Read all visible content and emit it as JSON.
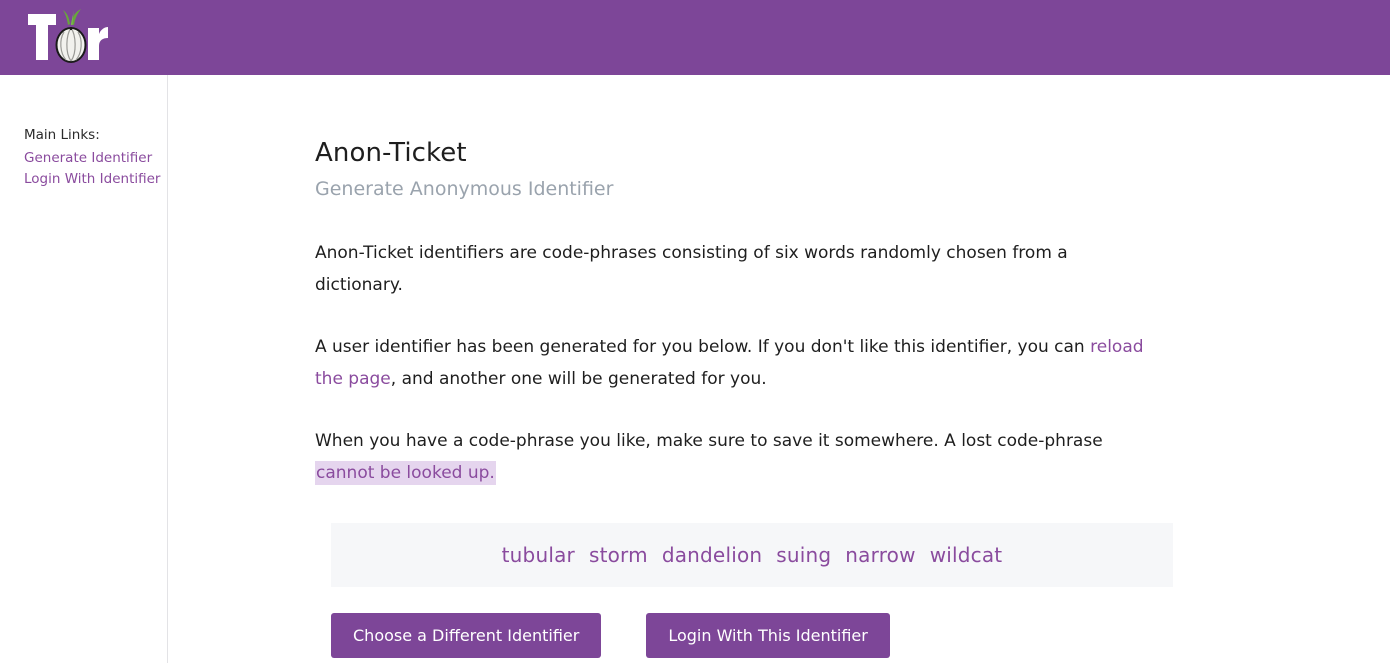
{
  "header": {
    "logo_text": "Tor",
    "logo_alt": "tor-onion-logo",
    "background_color": "#7d4698"
  },
  "sidebar": {
    "heading": "Main Links:",
    "links": [
      {
        "label": "Generate Identifier"
      },
      {
        "label": "Login With Identifier"
      }
    ],
    "link_color": "#8a4b9e"
  },
  "main": {
    "title": "Anon-Ticket",
    "subtitle": "Generate Anonymous Identifier",
    "paragraphs": {
      "p1": "Anon-Ticket identifiers are code-phrases consisting of six words randomly chosen from a dictionary.",
      "p2_before": "A user identifier has been generated for you below. If you don't like this identifier, you can ",
      "p2_link": "reload the page",
      "p2_after": ", and another one will be generated for you.",
      "p3_before": "When you have a code-phrase you like, make sure to save it somewhere. A lost code-phrase ",
      "p3_highlight": "cannot be looked up."
    },
    "code_phrase": {
      "words": [
        "tubular",
        "storm",
        "dandelion",
        "suing",
        "narrow",
        "wildcat"
      ],
      "text_color": "#8a4b9e",
      "background_color": "#f6f7f9"
    },
    "buttons": {
      "choose_different": "Choose a Different Identifier",
      "login_with_this": "Login With This Identifier",
      "background_color": "#7d4698"
    }
  }
}
